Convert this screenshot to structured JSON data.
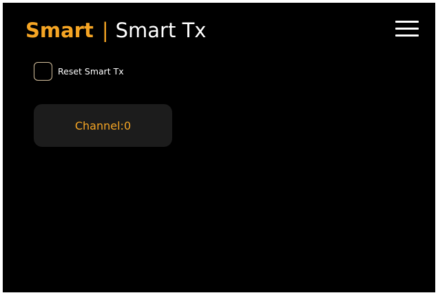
{
  "header": {
    "brand": "Smart",
    "separator": "|",
    "title": "Smart Tx",
    "menu_icon": "hamburger-menu-icon"
  },
  "options": {
    "reset_label": "Reset Smart Tx",
    "reset_checked": false
  },
  "channel": {
    "label": "Channel:0"
  },
  "colors": {
    "background": "#000000",
    "accent": "#f5a524",
    "text": "#ffffff",
    "card": "#1c1c1c",
    "checkbox_border": "#d8c3a0"
  }
}
